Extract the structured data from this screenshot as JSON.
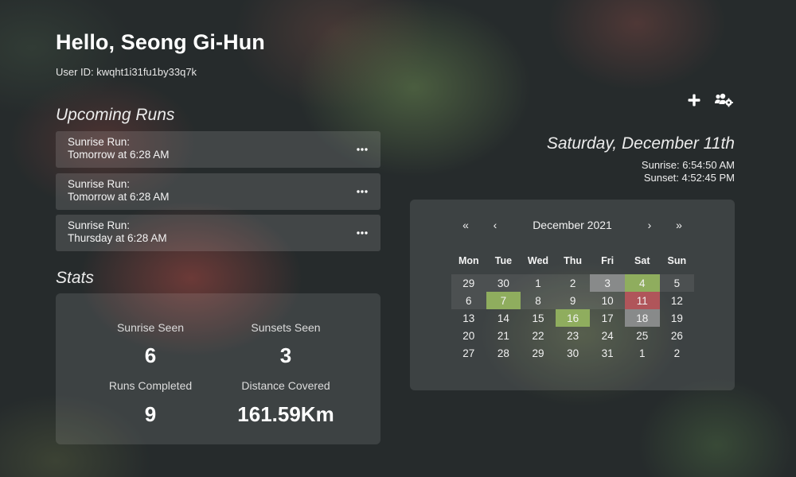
{
  "header": {
    "greeting": "Hello, Seong Gi-Hun",
    "user_id": "User ID: kwqht1i31fu1by33q7k"
  },
  "toolbar": {
    "add_icon": "plus-icon",
    "friends_icon": "users-gear-icon"
  },
  "runs": {
    "title": "Upcoming Runs",
    "items": [
      {
        "name": "Sunrise Run:",
        "when": "Tomorrow at 6:28 AM"
      },
      {
        "name": "Sunrise Run:",
        "when": "Tomorrow at 6:28 AM"
      },
      {
        "name": "Sunrise Run:",
        "when": "Thursday at 6:28 AM"
      }
    ]
  },
  "stats": {
    "title": "Stats",
    "sunrise_label": "Sunrise Seen",
    "sunrise_value": "6",
    "sunset_label": "Sunsets Seen",
    "sunset_value": "3",
    "runs_label": "Runs Completed",
    "runs_value": "9",
    "distance_label": "Distance Covered",
    "distance_value": "161.59Km"
  },
  "today": {
    "date": "Saturday, December 11th",
    "sunrise": "Sunrise: 6:54:50 AM",
    "sunset": "Sunset: 4:52:45 PM"
  },
  "calendar": {
    "month": "December 2021",
    "nav": {
      "prev_year": "«",
      "prev_month": "‹",
      "next_month": "›",
      "next_year": "»"
    },
    "weekdays": [
      "Mon",
      "Tue",
      "Wed",
      "Thu",
      "Fri",
      "Sat",
      "Sun"
    ],
    "days": [
      {
        "d": "29",
        "s": "dim"
      },
      {
        "d": "30",
        "s": "dim"
      },
      {
        "d": "1",
        "s": "dim"
      },
      {
        "d": "2",
        "s": "dim"
      },
      {
        "d": "3",
        "s": "gray"
      },
      {
        "d": "4",
        "s": "green"
      },
      {
        "d": "5",
        "s": "dim"
      },
      {
        "d": "6",
        "s": "dim"
      },
      {
        "d": "7",
        "s": "green"
      },
      {
        "d": "8",
        "s": "dim"
      },
      {
        "d": "9",
        "s": "dim"
      },
      {
        "d": "10",
        "s": "dim"
      },
      {
        "d": "11",
        "s": "red"
      },
      {
        "d": "12",
        "s": ""
      },
      {
        "d": "13",
        "s": ""
      },
      {
        "d": "14",
        "s": ""
      },
      {
        "d": "15",
        "s": ""
      },
      {
        "d": "16",
        "s": "green"
      },
      {
        "d": "17",
        "s": ""
      },
      {
        "d": "18",
        "s": "gray"
      },
      {
        "d": "19",
        "s": ""
      },
      {
        "d": "20",
        "s": ""
      },
      {
        "d": "21",
        "s": ""
      },
      {
        "d": "22",
        "s": ""
      },
      {
        "d": "23",
        "s": ""
      },
      {
        "d": "24",
        "s": ""
      },
      {
        "d": "25",
        "s": ""
      },
      {
        "d": "26",
        "s": ""
      },
      {
        "d": "27",
        "s": ""
      },
      {
        "d": "28",
        "s": ""
      },
      {
        "d": "29",
        "s": ""
      },
      {
        "d": "30",
        "s": ""
      },
      {
        "d": "31",
        "s": ""
      },
      {
        "d": "1",
        "s": ""
      },
      {
        "d": "2",
        "s": ""
      }
    ],
    "colors": {
      "run_completed": "#8fad5e",
      "today": "#b0555a",
      "past": "#888a8a"
    }
  }
}
